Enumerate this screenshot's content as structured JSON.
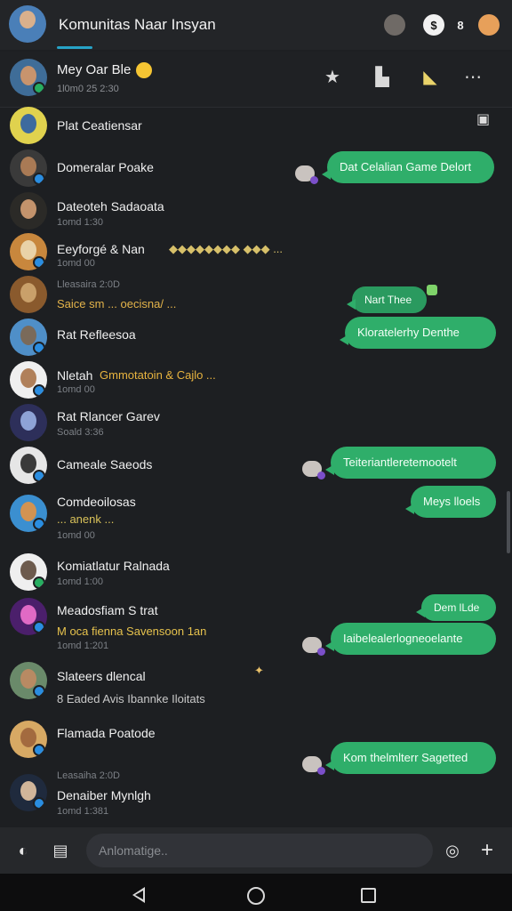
{
  "header": {
    "title": "Komunitas Naar Insyan"
  },
  "chat": {
    "name": "Mey Oar Ble",
    "sub": "1l0m0 25 2:30"
  },
  "composer": {
    "placeholder": "Anlomatige.."
  },
  "rows": [
    {
      "name": "Plat Ceatiensar",
      "sub": "",
      "line": "",
      "bubble": ""
    },
    {
      "name": "Domeralar Poake",
      "sub": "",
      "line": "",
      "bubble": "Dat Celalian Game Delort"
    },
    {
      "name": "Dateoteh Sadaoata",
      "sub": "1omd 1:30",
      "line": "",
      "bubble": ""
    },
    {
      "name": "Eeyforgé & Nan",
      "sub": "1omd 00",
      "line": "",
      "bubble": ""
    },
    {
      "name": "Lleasaira 2:0D",
      "sub": "",
      "line": "Saice sm ... oecisna/ ...",
      "bubble": ""
    },
    {
      "name": "Rat Refleesoa",
      "sub": "",
      "line": "",
      "bubble": "Kloratelerhy Denthe"
    },
    {
      "name": "Nletah",
      "sub": "1omd 00",
      "line": "Gmmotatoin & Cajlo ...",
      "bubble": ""
    },
    {
      "name": "Rat Rlancer Garev",
      "sub": "Soald 3:36",
      "line": "",
      "bubble": ""
    },
    {
      "name": "Cameale Saeods",
      "sub": "",
      "line": "",
      "bubble": "Teiteriantleretemootelt"
    },
    {
      "name": "Comdeoilosas",
      "sub": "1omd 00",
      "line": "... anenk ...",
      "bubble": "Meys lloels"
    },
    {
      "name": "Komiatlatur Ralnada",
      "sub": "1omd 1:00",
      "line": "",
      "bubble": ""
    },
    {
      "name": "Meadosfiam S trat",
      "sub": "1omd 1:201",
      "line": "M oca fienna Savensoon 1an",
      "bubble": "Dem lLde"
    },
    {
      "name": "Slateers dlencal",
      "sub": "",
      "line": "8 Eaded  Avis  Ibannke  Iloitats",
      "bubble": "Iaibelealerlogneoelante"
    },
    {
      "name": "Flamada Poatode",
      "sub": "",
      "line": "",
      "bubble": ""
    },
    {
      "name": "Leasaiha 2:0D",
      "sub": "1omd 1:381",
      "line": "Denaiber  Mynlgh",
      "bubble": "Kom thelmlterr Sagetted"
    }
  ],
  "extra_bubbles": {
    "small": "Nart Thee"
  }
}
